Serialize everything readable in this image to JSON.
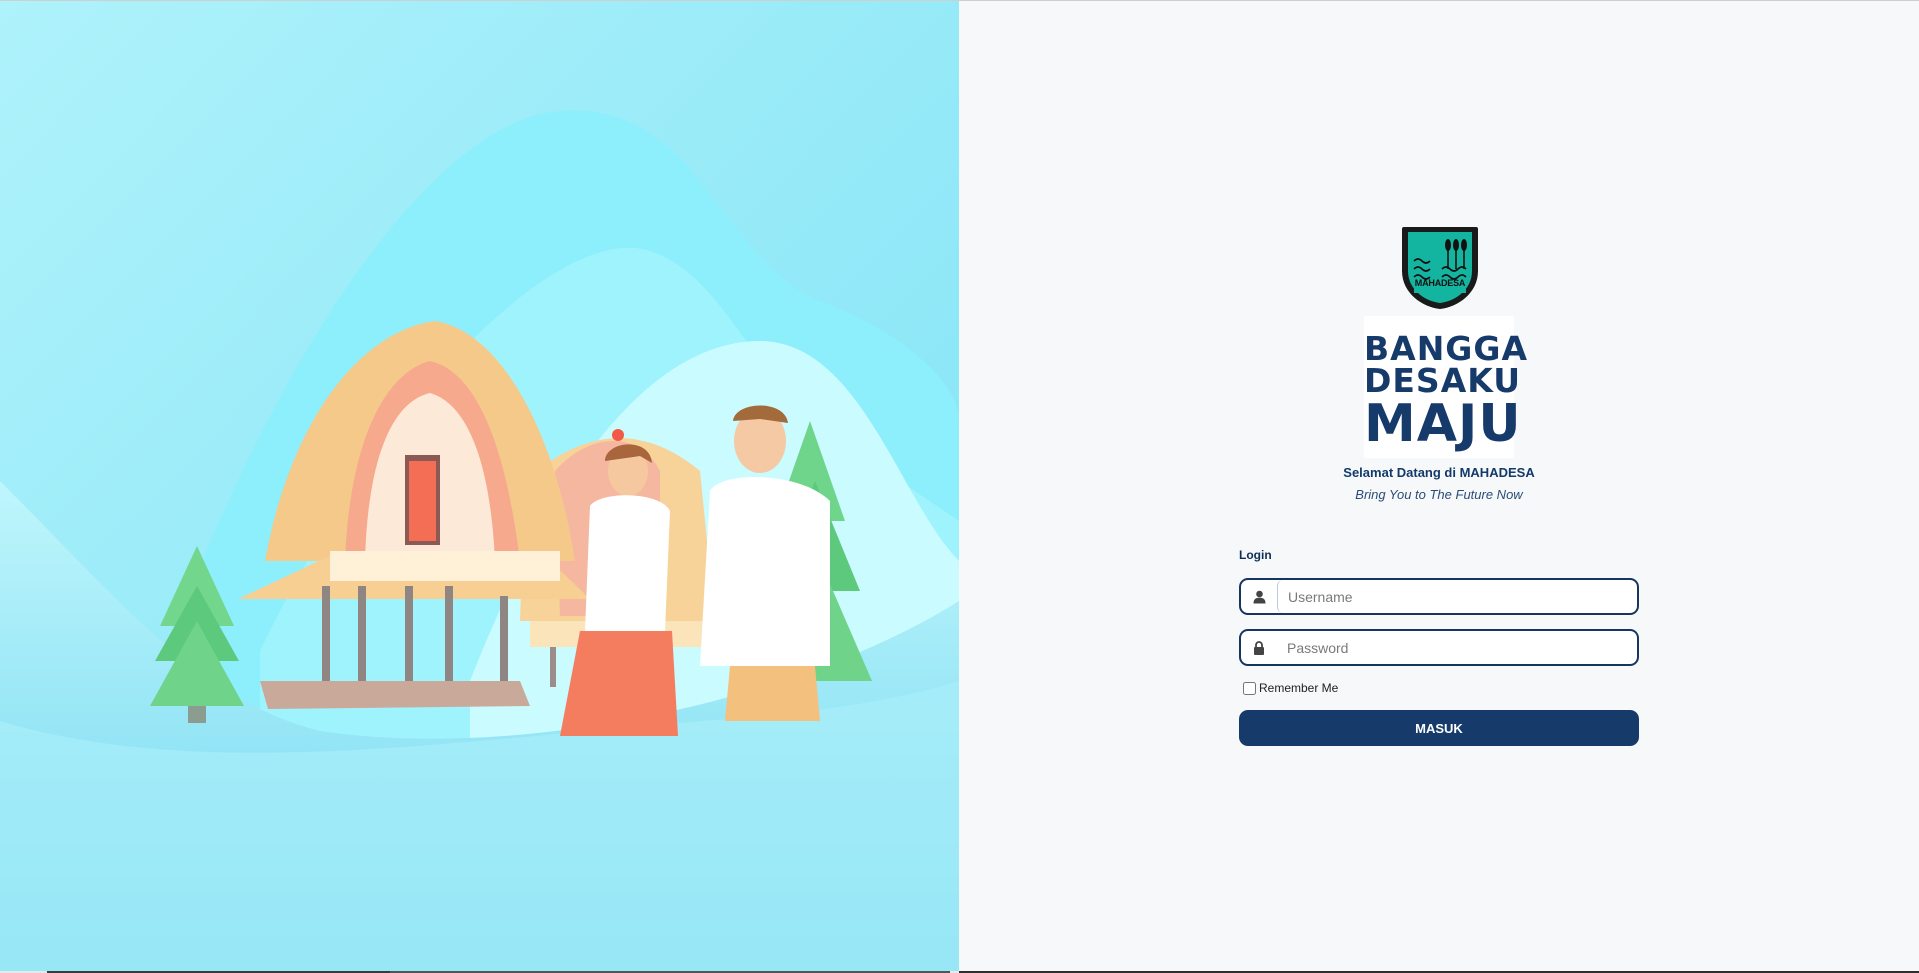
{
  "brand": {
    "emblem_name": "MAHADESA",
    "slogan_lines": [
      "BANGGA",
      "DESAKU",
      "MAJU"
    ]
  },
  "welcome": {
    "title": "Selamat Datang di MAHADESA",
    "subtitle": "Bring You to The Future Now"
  },
  "login": {
    "heading": "Login",
    "username_placeholder": "Username",
    "password_placeholder": "Password",
    "remember_label": "Remember Me",
    "submit_label": "MASUK"
  },
  "icons": {
    "username": "user-icon",
    "password": "lock-icon"
  },
  "colors": {
    "primary": "#163a6a",
    "emblem_teal": "#14b5a0",
    "hero_sky": "#8ceaf7"
  }
}
